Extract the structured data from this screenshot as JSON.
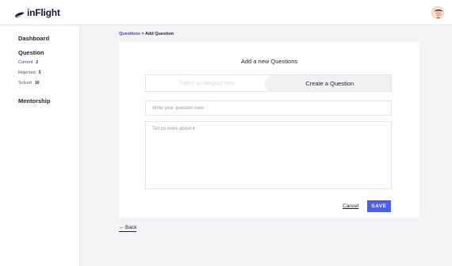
{
  "app": {
    "name": "inFlight"
  },
  "sidebar": {
    "dashboard": "Dashboard",
    "question": "Question",
    "items": [
      {
        "label": "Current",
        "count": "2"
      },
      {
        "label": "Rejected",
        "count": "5"
      },
      {
        "label": "Solved",
        "count": "10"
      }
    ],
    "mentorship": "Mentorship"
  },
  "breadcrumb": {
    "parent": "Questions",
    "separator": " > ",
    "current": "Add Question"
  },
  "form": {
    "title": "Add a new Questions",
    "tabs": [
      {
        "label": "Select a category item"
      },
      {
        "label": "Create a Question"
      }
    ],
    "question_placeholder": "Write your question here",
    "details_placeholder": "Tell us more about it",
    "cancel_label": "Cancel",
    "save_label": "SAVE"
  },
  "back_label": "Back",
  "colors": {
    "accent": "#4a5ef0",
    "link": "#2f3cc8",
    "brand": "#141a3c"
  }
}
